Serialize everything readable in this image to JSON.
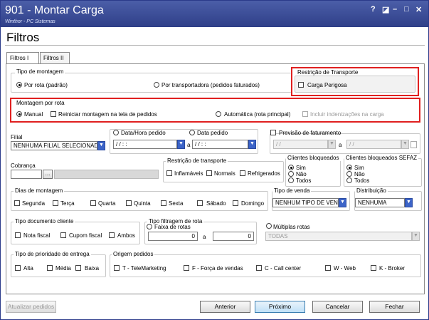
{
  "window": {
    "title": "901 - Montar Carga",
    "subtitle": "Winthor - PC Sistemas",
    "controls": [
      "?",
      "◪",
      "–",
      "□",
      "✕"
    ]
  },
  "page_title": "Filtros",
  "tabs": [
    {
      "label": "Filtros I",
      "active": true
    },
    {
      "label": "Filtros II",
      "active": false
    }
  ],
  "tipo_montagem": {
    "legend": "Tipo de montagem",
    "por_rota": "Por rota (padrão)",
    "por_transportadora": "Por transportadora (pedidos faturados)"
  },
  "restricao_transporte_top": {
    "legend": "Restrição de Transporte",
    "carga_perigosa": "Carga Perigosa"
  },
  "montagem_por_rota": {
    "legend": "Montagem por rota",
    "manual": "Manual",
    "reiniciar": "Reiniciar montagem na tela de pedidos",
    "automatica": "Automática (rota principal)",
    "incluir_indenizacoes": "Incluir indenizações na carga"
  },
  "filial": {
    "label": "Filial",
    "value": "NENHUMA FILIAL SELECIONADA"
  },
  "datas": {
    "data_hora_pedido": "Data/Hora pedido",
    "data_pedido": "Data pedido",
    "date_from": "/ /   : :",
    "date_to": "/ /   : :",
    "a": "a"
  },
  "previsao": {
    "label": "Previsão de faturamento",
    "from": "/ /",
    "to": "/ /",
    "a": "a"
  },
  "cobranca": {
    "label": "Cobrança",
    "dots": "..."
  },
  "restricao_transporte": {
    "legend": "Restrição de transporte",
    "inflamaveis": "Inflamáveis",
    "normais": "Normais",
    "refrigerados": "Refrigerados"
  },
  "clientes_bloqueados": {
    "legend": "Clientes bloqueados",
    "options": [
      "Sim",
      "Não",
      "Todos"
    ]
  },
  "clientes_bloqueados_sefaz": {
    "legend": "Clientes bloqueados SEFAZ",
    "options": [
      "Sim",
      "Não",
      "Todos"
    ]
  },
  "dias_montagem": {
    "legend": "Dias de montagem",
    "days": [
      "Segunda",
      "Terça",
      "Quarta",
      "Quinta",
      "Sexta",
      "Sábado",
      "Domingo"
    ]
  },
  "tipo_venda": {
    "label": "Tipo de venda",
    "value": "NENHUM TIPO DE VENDA"
  },
  "distribuicao": {
    "label": "Distribuição",
    "value": "NENHUMA"
  },
  "tipo_documento": {
    "legend": "Tipo documento cliente",
    "nota_fiscal": "Nota fiscal",
    "cupom_fiscal": "Cupom fiscal",
    "ambos": "Ambos"
  },
  "tipo_filtragem": {
    "legend": "Tipo filtragem de rota",
    "faixa": "Faixa de rotas",
    "from": "0",
    "a": "a",
    "to": "0",
    "multiplas": "Múltiplas rotas",
    "todas": "TODAS"
  },
  "prioridade": {
    "legend": "Tipo de prioridade de  entrega",
    "options": [
      "Alta",
      "Média",
      "Baixa"
    ]
  },
  "origem": {
    "legend": "Origem pedidos",
    "options": [
      "T - TeleMarketing",
      "F - Força de vendas",
      "C - Call center",
      "W - Web",
      "K - Broker"
    ]
  },
  "footer": {
    "atualizar": "Atualizar pedidos",
    "anterior": "Anterior",
    "proximo": "Próximo",
    "cancelar": "Cancelar",
    "fechar": "Fechar"
  }
}
